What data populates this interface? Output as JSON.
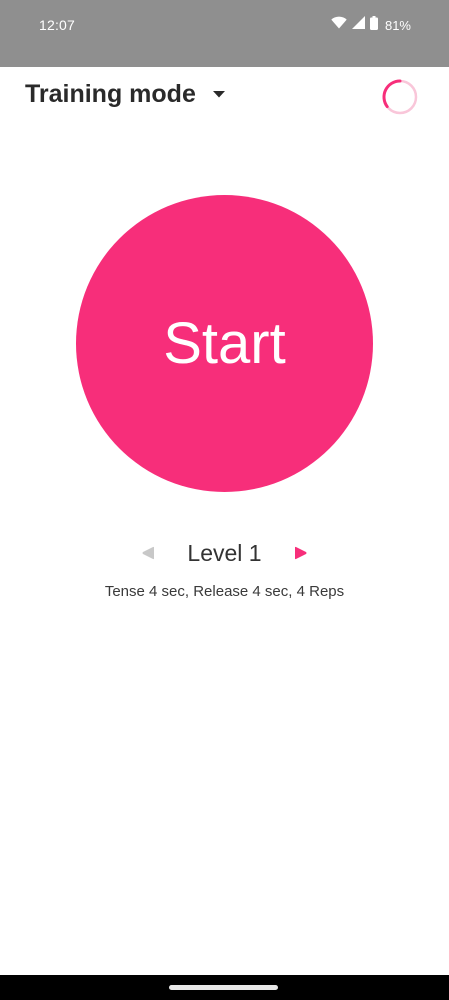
{
  "status_bar": {
    "time": "12:07",
    "battery": "81%",
    "icons": [
      "wifi-icon",
      "signal-icon",
      "battery-icon"
    ]
  },
  "app_bar": {
    "title": "Training mode",
    "dropdown_icon": "arrow-drop-down-icon",
    "progress_icon": "progress-ring-icon"
  },
  "main": {
    "start_label": "Start",
    "level": {
      "label": "Level 1",
      "description": "Tense 4 sec, Release 4 sec, 4 Reps",
      "prev_icon": "chevron-left-icon",
      "next_icon": "chevron-right-icon",
      "prev_enabled": false,
      "next_enabled": true
    }
  },
  "colors": {
    "accent": "#f72e7a",
    "accent_light": "#f9c6d9",
    "disabled": "#c8c8c8",
    "status_bar": "#8f8f8f",
    "text_dark": "#2a2a2a"
  }
}
